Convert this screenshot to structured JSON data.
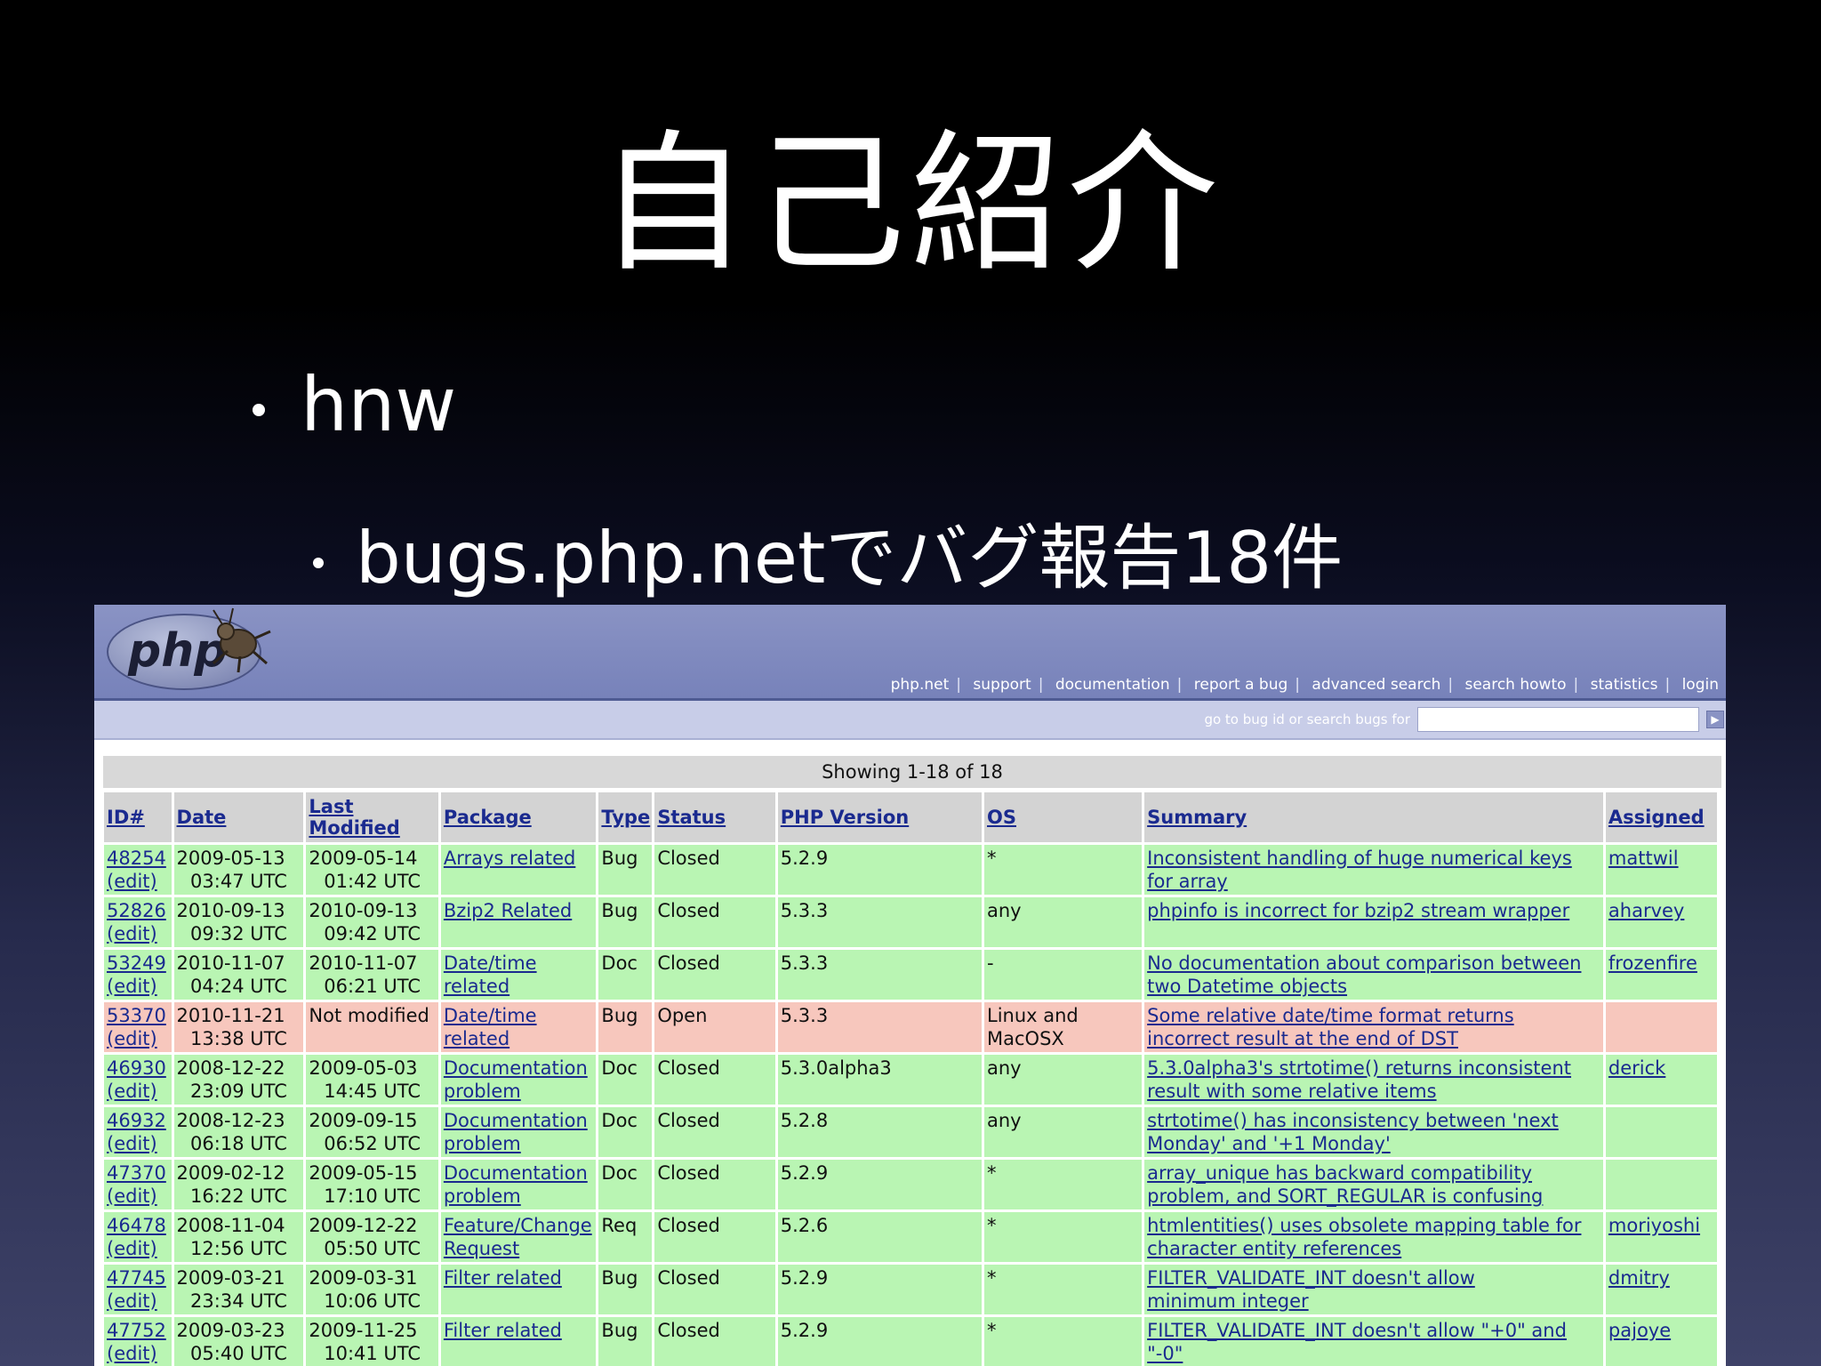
{
  "slide": {
    "title": "自己紹介",
    "bullets": [
      "hnw",
      "bugs.php.netでバグ報告18件"
    ]
  },
  "php_site": {
    "logo_text": "php",
    "nav": [
      "php.net",
      "support",
      "documentation",
      "report a bug",
      "advanced search",
      "search howto",
      "statistics",
      "login"
    ],
    "search_label": "go to bug id or search bugs for",
    "search_value": "",
    "go_icon": "arrow-right-icon",
    "showing": "Showing 1-18 of 18",
    "columns": [
      "ID#",
      "Date",
      "Last Modified",
      "Package",
      "Type",
      "Status",
      "PHP Version",
      "OS",
      "Summary",
      "Assigned"
    ],
    "rows": [
      {
        "id": "48254",
        "edit": "(edit)",
        "date": "2009-05-13",
        "date_time": "03:47 UTC",
        "mod": "2009-05-14",
        "mod_time": "01:42 UTC",
        "pkg1": "Arrays related",
        "pkg2": "",
        "type": "Bug",
        "status": "Closed",
        "ver": "5.2.9",
        "os1": "*",
        "os2": "",
        "sum1": "Inconsistent handling of huge numerical keys",
        "sum2": "for array",
        "assigned": "mattwil",
        "state": "closed"
      },
      {
        "id": "52826",
        "edit": "(edit)",
        "date": "2010-09-13",
        "date_time": "09:32 UTC",
        "mod": "2010-09-13",
        "mod_time": "09:42 UTC",
        "pkg1": "Bzip2 Related",
        "pkg2": "",
        "type": "Bug",
        "status": "Closed",
        "ver": "5.3.3",
        "os1": "any",
        "os2": "",
        "sum1": "phpinfo is incorrect for bzip2 stream wrapper",
        "sum2": "",
        "assigned": "aharvey",
        "state": "closed"
      },
      {
        "id": "53249",
        "edit": "(edit)",
        "date": "2010-11-07",
        "date_time": "04:24 UTC",
        "mod": "2010-11-07",
        "mod_time": "06:21 UTC",
        "pkg1": "Date/time",
        "pkg2": "related",
        "type": "Doc",
        "status": "Closed",
        "ver": "5.3.3",
        "os1": "-",
        "os2": "",
        "sum1": "No documentation about comparison between",
        "sum2": "two Datetime objects",
        "assigned": "frozenfire",
        "state": "closed"
      },
      {
        "id": "53370",
        "edit": "(edit)",
        "date": "2010-11-21",
        "date_time": "13:38 UTC",
        "mod": "Not modified",
        "mod_time": "",
        "pkg1": "Date/time",
        "pkg2": "related",
        "type": "Bug",
        "status": "Open",
        "ver": "5.3.3",
        "os1": "Linux and",
        "os2": "MacOSX",
        "sum1": "Some relative date/time format returns",
        "sum2": "incorrect result at the end of DST",
        "assigned": "",
        "state": "open"
      },
      {
        "id": "46930",
        "edit": "(edit)",
        "date": "2008-12-22",
        "date_time": "23:09 UTC",
        "mod": "2009-05-03",
        "mod_time": "14:45 UTC",
        "pkg1": "Documentation",
        "pkg2": "problem",
        "type": "Doc",
        "status": "Closed",
        "ver": "5.3.0alpha3",
        "os1": "any",
        "os2": "",
        "sum1": "5.3.0alpha3's strtotime() returns inconsistent",
        "sum2": "result with some relative items",
        "assigned": "derick",
        "state": "closed"
      },
      {
        "id": "46932",
        "edit": "(edit)",
        "date": "2008-12-23",
        "date_time": "06:18 UTC",
        "mod": "2009-09-15",
        "mod_time": "06:52 UTC",
        "pkg1": "Documentation",
        "pkg2": "problem",
        "type": "Doc",
        "status": "Closed",
        "ver": "5.2.8",
        "os1": "any",
        "os2": "",
        "sum1": "strtotime() has inconsistency between 'next",
        "sum2": "Monday' and '+1 Monday'",
        "assigned": "",
        "state": "closed"
      },
      {
        "id": "47370",
        "edit": "(edit)",
        "date": "2009-02-12",
        "date_time": "16:22 UTC",
        "mod": "2009-05-15",
        "mod_time": "17:10 UTC",
        "pkg1": "Documentation",
        "pkg2": "problem",
        "type": "Doc",
        "status": "Closed",
        "ver": "5.2.9",
        "os1": "*",
        "os2": "",
        "sum1": "array_unique has backward compatibility",
        "sum2": "problem, and SORT_REGULAR is confusing",
        "assigned": "",
        "state": "closed"
      },
      {
        "id": "46478",
        "edit": "(edit)",
        "date": "2008-11-04",
        "date_time": "12:56 UTC",
        "mod": "2009-12-22",
        "mod_time": "05:50 UTC",
        "pkg1": "Feature/Change",
        "pkg2": "Request",
        "type": "Req",
        "status": "Closed",
        "ver": "5.2.6",
        "os1": "*",
        "os2": "",
        "sum1": "htmlentities() uses obsolete mapping table for",
        "sum2": "character entity references",
        "assigned": "moriyoshi",
        "state": "closed"
      },
      {
        "id": "47745",
        "edit": "(edit)",
        "date": "2009-03-21",
        "date_time": "23:34 UTC",
        "mod": "2009-03-31",
        "mod_time": "10:06 UTC",
        "pkg1": "Filter related",
        "pkg2": "",
        "type": "Bug",
        "status": "Closed",
        "ver": "5.2.9",
        "os1": "*",
        "os2": "",
        "sum1": "FILTER_VALIDATE_INT doesn't allow",
        "sum2": "minimum integer",
        "assigned": "dmitry",
        "state": "closed"
      },
      {
        "id": "47752",
        "edit": "(edit)",
        "date": "2009-03-23",
        "date_time": "05:40 UTC",
        "mod": "2009-11-25",
        "mod_time": "10:41 UTC",
        "pkg1": "Filter related",
        "pkg2": "",
        "type": "Bug",
        "status": "Closed",
        "ver": "5.2.9",
        "os1": "*",
        "os2": "",
        "sum1": "FILTER_VALIDATE_INT doesn't allow \"+0\" and",
        "sum2": "\"-0\"",
        "assigned": "pajoye",
        "state": "closed"
      }
    ]
  }
}
